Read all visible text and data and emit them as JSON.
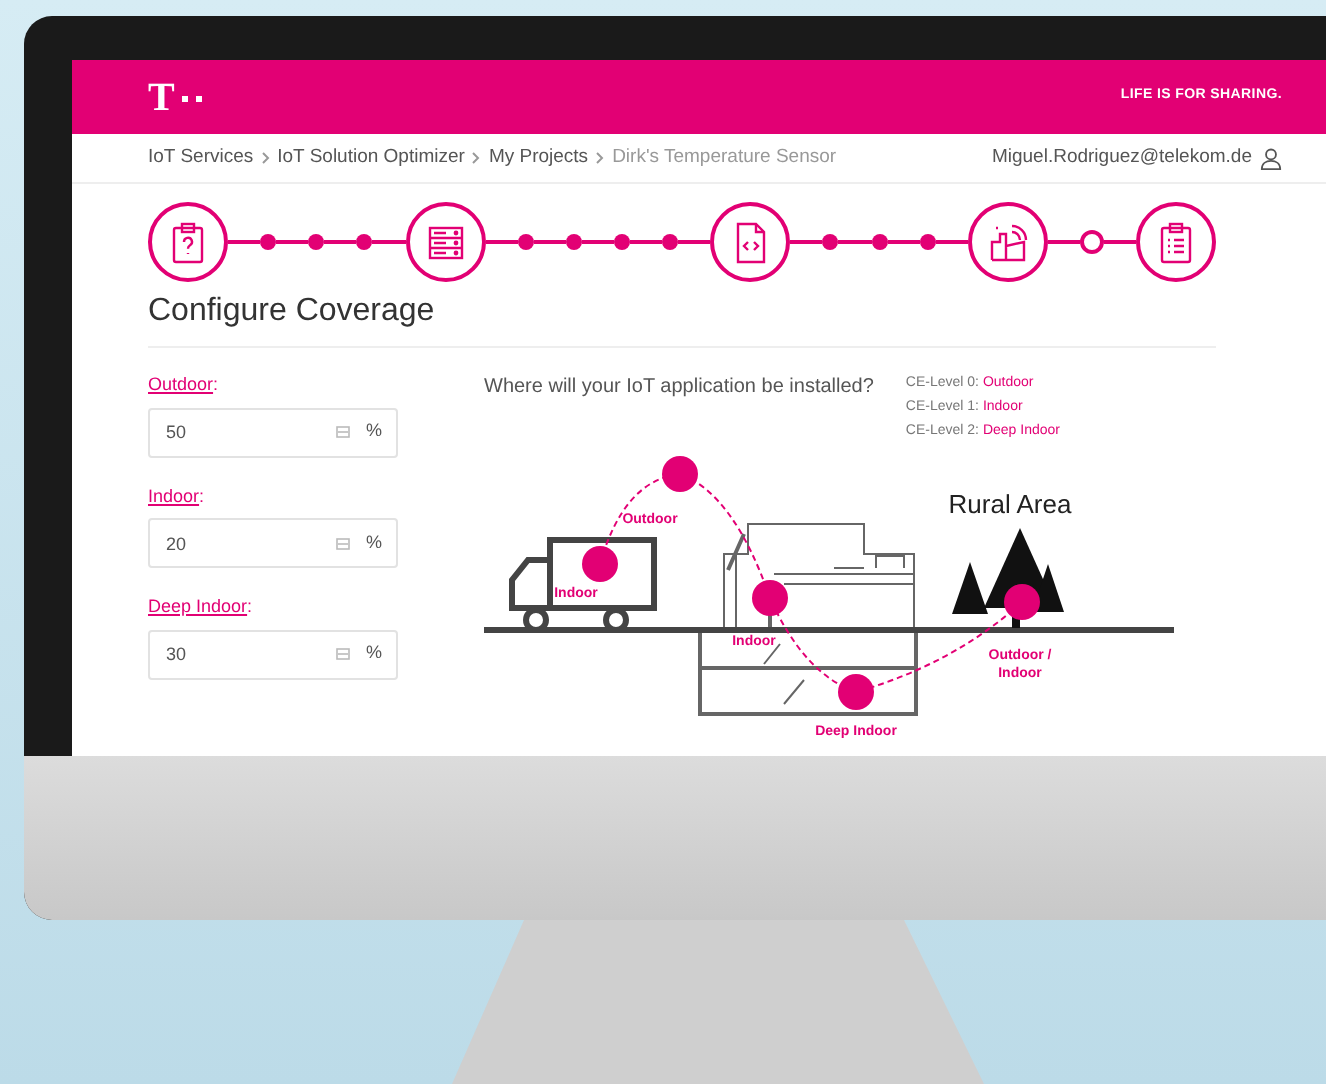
{
  "header": {
    "logo": "T",
    "slogan": "LIFE IS FOR SHARING."
  },
  "breadcrumb": [
    {
      "label": "IoT Services",
      "current": false
    },
    {
      "label": "IoT Solution Optimizer",
      "current": false
    },
    {
      "label": "My Projects",
      "current": false
    },
    {
      "label": "Dirk's Temperature Sensor",
      "current": true
    }
  ],
  "user": {
    "email": "Miguel.Rodriguez@telekom.de"
  },
  "stepper": [
    {
      "kind": "step"
    },
    {
      "kind": "dot",
      "completed": true
    },
    {
      "kind": "dot",
      "completed": true
    },
    {
      "kind": "dot",
      "completed": true
    },
    {
      "kind": "step"
    },
    {
      "kind": "dot",
      "completed": true
    },
    {
      "kind": "dot",
      "completed": true
    },
    {
      "kind": "dot",
      "completed": true
    },
    {
      "kind": "dot",
      "completed": true
    },
    {
      "kind": "step"
    },
    {
      "kind": "dot",
      "completed": true
    },
    {
      "kind": "dot",
      "completed": true
    },
    {
      "kind": "dot",
      "completed": true
    },
    {
      "kind": "step"
    },
    {
      "kind": "dot",
      "completed": false
    },
    {
      "kind": "step"
    }
  ],
  "title": "Configure Coverage",
  "fields": [
    {
      "label": "Outdoor",
      "suffix": ":",
      "value": "50",
      "unit": "%"
    },
    {
      "label": "Indoor",
      "suffix": ":",
      "value": "20",
      "unit": "%"
    },
    {
      "label": "Deep Indoor",
      "suffix": ":",
      "value": "30",
      "unit": "%"
    }
  ],
  "question": "Where will your IoT application be installed?",
  "legend": [
    {
      "label": "CE-Level 0:",
      "value": "Outdoor"
    },
    {
      "label": "CE-Level 1:",
      "value": "Indoor"
    },
    {
      "label": "CE-Level 2:",
      "value": "Deep Indoor"
    }
  ],
  "illustration": {
    "area_title": "Rural Area",
    "labels": [
      "Outdoor",
      "Indoor",
      "Indoor",
      "Deep Indoor",
      "Outdoor / Indoor"
    ]
  }
}
